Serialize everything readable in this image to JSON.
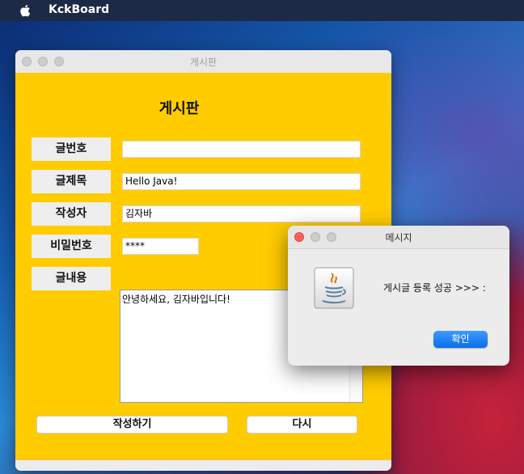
{
  "menubar": {
    "app_name": "KckBoard"
  },
  "main_window": {
    "title": "게시판",
    "heading": "게시판",
    "labels": {
      "post_number": "글번호",
      "post_title": "글제목",
      "author": "작성자",
      "password": "비밀번호",
      "content": "글내용"
    },
    "fields": {
      "post_number": "",
      "post_title": "Hello Java!",
      "author": "김자바",
      "password": "****",
      "content": "안녕하세요, 김자바입니다!"
    },
    "buttons": {
      "write": "작성하기",
      "reset": "다시"
    }
  },
  "dialog": {
    "title": "메시지",
    "message": "게시글 등록 성공 >>> :",
    "ok_label": "확인",
    "icon": "java-icon"
  },
  "colors": {
    "board_background": "#ffcc00",
    "ok_button": "#0a6fe8"
  }
}
